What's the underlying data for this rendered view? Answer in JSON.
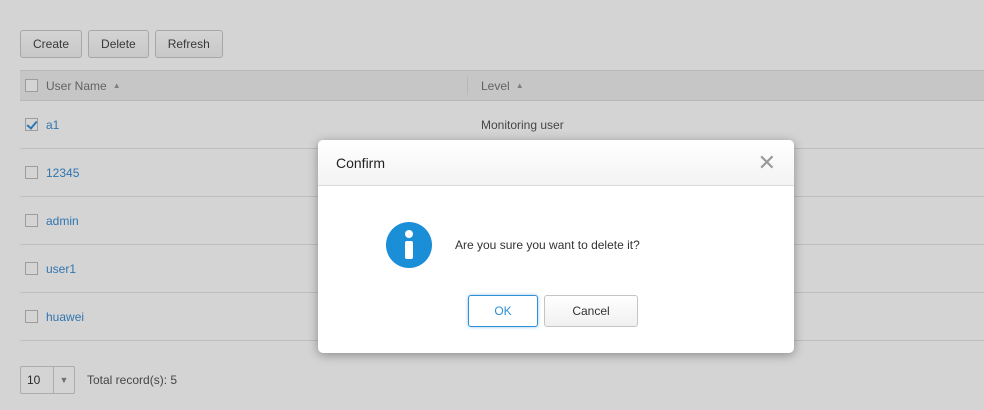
{
  "toolbar": {
    "create_label": "Create",
    "delete_label": "Delete",
    "refresh_label": "Refresh"
  },
  "table": {
    "headers": {
      "user_name": "User Name",
      "level": "Level"
    },
    "rows": [
      {
        "name": "a1",
        "level": "Monitoring user",
        "checked": true
      },
      {
        "name": "12345",
        "level": "",
        "checked": false
      },
      {
        "name": "admin",
        "level": "",
        "checked": false
      },
      {
        "name": "user1",
        "level": "",
        "checked": false
      },
      {
        "name": "huawei",
        "level": "",
        "checked": false
      }
    ]
  },
  "footer": {
    "page_size": "10",
    "total": "Total record(s): 5"
  },
  "dialog": {
    "title": "Confirm",
    "message": "Are you sure you want to delete it?",
    "ok_label": "OK",
    "cancel_label": "Cancel",
    "icon": "info-icon",
    "close_icon": "close-icon"
  },
  "colors": {
    "link": "#3a8ed4",
    "accent": "#2f8fd6",
    "info_icon": "#1a8fd8"
  }
}
